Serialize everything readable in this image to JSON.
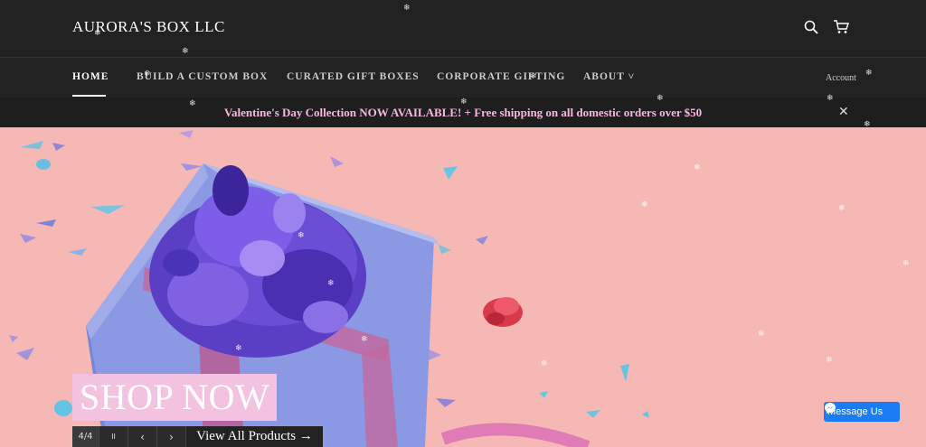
{
  "header": {
    "logo": "AURORA'S BOX LLC",
    "icons": [
      "search-icon",
      "cart-icon"
    ]
  },
  "nav": {
    "items": [
      {
        "label": "HOME"
      },
      {
        "label": "BUILD A CUSTOM BOX"
      },
      {
        "label": "CURATED GIFT BOXES"
      },
      {
        "label": "CORPORATE GIFTING"
      },
      {
        "label": "ABOUT ˅"
      }
    ],
    "account": "Account"
  },
  "announcement": {
    "text": "Valentine's Day Collection NOW AVAILABLE! + Free shipping on all domestic orders over $50",
    "close": "✕"
  },
  "hero": {
    "headline": "SHOP NOW",
    "counter": "4/4",
    "pause": "II",
    "prev": "‹",
    "next": "›",
    "cta": "View All Products →"
  },
  "messenger": {
    "label": "Message Us"
  },
  "colors": {
    "accent_pink": "#f7b8dd",
    "hero_bg": "#f6b8b5",
    "messenger_blue": "#1a7df5"
  }
}
